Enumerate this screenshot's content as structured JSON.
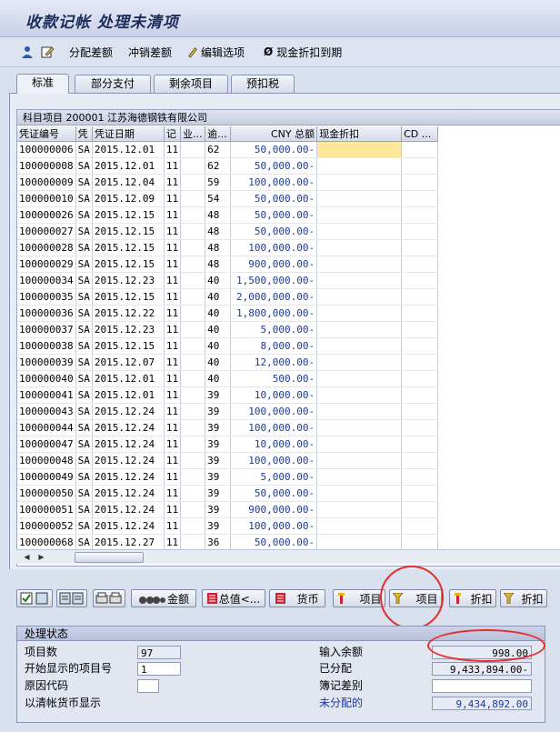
{
  "title": "收款记帐 处理未清项",
  "toolbar": {
    "distribute": "分配差额",
    "writeoff": "冲销差额",
    "edit_options": "编辑选项",
    "cash_discount": "现金折扣到期"
  },
  "tabs": [
    "标准",
    "部分支付",
    "剩余项目",
    "预扣税"
  ],
  "grid": {
    "title": "科目项目 200001 江苏海德钢铁有限公司",
    "headers": [
      "凭证编号",
      "凭",
      "凭证日期",
      "记",
      "业...",
      "逾...",
      "CNY 总额",
      "现金折扣",
      "CD ..."
    ],
    "rows": [
      [
        "100000006",
        "SA",
        "2015.12.01",
        "11",
        "",
        "62",
        "50,000.00-"
      ],
      [
        "100000008",
        "SA",
        "2015.12.01",
        "11",
        "",
        "62",
        "50,000.00-"
      ],
      [
        "100000009",
        "SA",
        "2015.12.04",
        "11",
        "",
        "59",
        "100,000.00-"
      ],
      [
        "100000010",
        "SA",
        "2015.12.09",
        "11",
        "",
        "54",
        "50,000.00-"
      ],
      [
        "100000026",
        "SA",
        "2015.12.15",
        "11",
        "",
        "48",
        "50,000.00-"
      ],
      [
        "100000027",
        "SA",
        "2015.12.15",
        "11",
        "",
        "48",
        "50,000.00-"
      ],
      [
        "100000028",
        "SA",
        "2015.12.15",
        "11",
        "",
        "48",
        "100,000.00-"
      ],
      [
        "100000029",
        "SA",
        "2015.12.15",
        "11",
        "",
        "48",
        "900,000.00-"
      ],
      [
        "100000034",
        "SA",
        "2015.12.23",
        "11",
        "",
        "40",
        "1,500,000.00-"
      ],
      [
        "100000035",
        "SA",
        "2015.12.15",
        "11",
        "",
        "40",
        "2,000,000.00-"
      ],
      [
        "100000036",
        "SA",
        "2015.12.22",
        "11",
        "",
        "40",
        "1,800,000.00-"
      ],
      [
        "100000037",
        "SA",
        "2015.12.23",
        "11",
        "",
        "40",
        "5,000.00-"
      ],
      [
        "100000038",
        "SA",
        "2015.12.15",
        "11",
        "",
        "40",
        "8,000.00-"
      ],
      [
        "100000039",
        "SA",
        "2015.12.07",
        "11",
        "",
        "40",
        "12,000.00-"
      ],
      [
        "100000040",
        "SA",
        "2015.12.01",
        "11",
        "",
        "40",
        "500.00-"
      ],
      [
        "100000041",
        "SA",
        "2015.12.01",
        "11",
        "",
        "39",
        "10,000.00-"
      ],
      [
        "100000043",
        "SA",
        "2015.12.24",
        "11",
        "",
        "39",
        "100,000.00-"
      ],
      [
        "100000044",
        "SA",
        "2015.12.24",
        "11",
        "",
        "39",
        "100,000.00-"
      ],
      [
        "100000047",
        "SA",
        "2015.12.24",
        "11",
        "",
        "39",
        "10,000.00-"
      ],
      [
        "100000048",
        "SA",
        "2015.12.24",
        "11",
        "",
        "39",
        "100,000.00-"
      ],
      [
        "100000049",
        "SA",
        "2015.12.24",
        "11",
        "",
        "39",
        "5,000.00-"
      ],
      [
        "100000050",
        "SA",
        "2015.12.24",
        "11",
        "",
        "39",
        "50,000.00-"
      ],
      [
        "100000051",
        "SA",
        "2015.12.24",
        "11",
        "",
        "39",
        "900,000.00-"
      ],
      [
        "100000052",
        "SA",
        "2015.12.24",
        "11",
        "",
        "39",
        "100,000.00-"
      ],
      [
        "100000068",
        "SA",
        "2015.12.27",
        "11",
        "",
        "36",
        "50,000.00-"
      ]
    ]
  },
  "buttons": {
    "amount": "金额",
    "total": "总值<...",
    "currency": "货币",
    "item1": "项目",
    "item2": "项目",
    "discount1": "折扣",
    "discount2": "折扣"
  },
  "status": {
    "header": "处理状态",
    "item_count_label": "项目数",
    "item_count": "97",
    "first_item_label": "开始显示的项目号",
    "first_item": "1",
    "reason_label": "原因代码",
    "reason": "",
    "clearing_label": "以清帐货币显示",
    "entered_label": "输入余额",
    "entered": "998.00",
    "assigned_label": "已分配",
    "assigned": "9,433,894.00-",
    "diff_label": "簿记差别",
    "diff": "",
    "unassigned_label": "未分配的",
    "unassigned": "9,434,892.00"
  },
  "colors": {
    "accent": "#1a3a9e",
    "highlight": "#fde79a",
    "annotation": "#e42d2d"
  }
}
